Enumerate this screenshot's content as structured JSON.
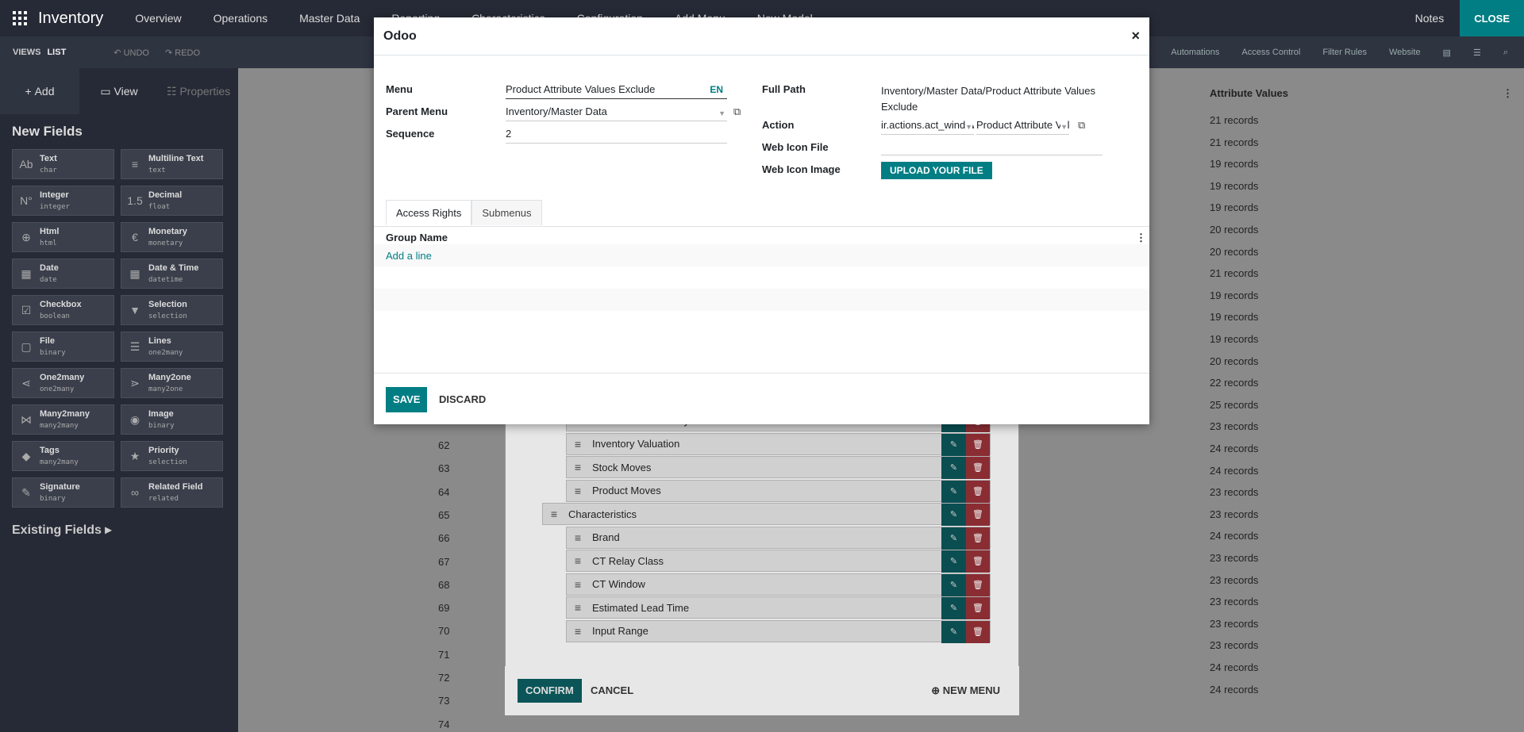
{
  "topbar": {
    "app_name": "Inventory",
    "menus": [
      "Overview",
      "Operations",
      "Master Data",
      "Reporting",
      "Characteristics",
      "Configuration",
      "Add Menu",
      "New Model"
    ],
    "notes": "Notes",
    "close": "CLOSE"
  },
  "subbar": {
    "views": "VIEWS",
    "list": "LIST",
    "undo": "UNDO",
    "redo": "REDO",
    "right_items": [
      "ations",
      "Automations",
      "Access Control",
      "Filter Rules",
      "Website"
    ]
  },
  "sidebar": {
    "tabs": {
      "add": "Add",
      "view": "View",
      "properties": "Properties"
    },
    "new_fields_title": "New Fields",
    "fields": [
      {
        "name": "Text",
        "type": "char",
        "icon": "Ab"
      },
      {
        "name": "Multiline Text",
        "type": "text",
        "icon": "≡"
      },
      {
        "name": "Integer",
        "type": "integer",
        "icon": "N°"
      },
      {
        "name": "Decimal",
        "type": "float",
        "icon": "1.5"
      },
      {
        "name": "Html",
        "type": "html",
        "icon": "⊕"
      },
      {
        "name": "Monetary",
        "type": "monetary",
        "icon": "€"
      },
      {
        "name": "Date",
        "type": "date",
        "icon": "▦"
      },
      {
        "name": "Date & Time",
        "type": "datetime",
        "icon": "▦"
      },
      {
        "name": "Checkbox",
        "type": "boolean",
        "icon": "☑"
      },
      {
        "name": "Selection",
        "type": "selection",
        "icon": "▼"
      },
      {
        "name": "File",
        "type": "binary",
        "icon": "▢"
      },
      {
        "name": "Lines",
        "type": "one2many",
        "icon": "☰"
      },
      {
        "name": "One2many",
        "type": "one2many",
        "icon": "⋖"
      },
      {
        "name": "Many2one",
        "type": "many2one",
        "icon": "⋗"
      },
      {
        "name": "Many2many",
        "type": "many2many",
        "icon": "⋈"
      },
      {
        "name": "Image",
        "type": "binary",
        "icon": "◉"
      },
      {
        "name": "Tags",
        "type": "many2many",
        "icon": "◆"
      },
      {
        "name": "Priority",
        "type": "selection",
        "icon": "★"
      },
      {
        "name": "Signature",
        "type": "binary",
        "icon": "✎"
      },
      {
        "name": "Related Field",
        "type": "related",
        "icon": "∞"
      }
    ],
    "existing_fields": "Existing Fields"
  },
  "list": {
    "column_header": "Attribute Values",
    "records": [
      "21 records",
      "21 records",
      "19 records",
      "19 records",
      "19 records",
      "20 records",
      "20 records",
      "21 records",
      "19 records",
      "19 records",
      "19 records",
      "20 records",
      "22 records",
      "25 records",
      "23 records",
      "24 records",
      "24 records",
      "23 records",
      "23 records",
      "24 records",
      "23 records",
      "23 records",
      "23 records",
      "23 records",
      "23 records",
      "24 records",
      "24 records"
    ],
    "row_numbers": [
      "62",
      "63",
      "64",
      "65",
      "66",
      "67",
      "68",
      "69",
      "70",
      "71",
      "72",
      "73",
      "74"
    ]
  },
  "menu_editor": {
    "items": [
      {
        "label": "Forecasted Inventory",
        "level": 2
      },
      {
        "label": "Inventory Valuation",
        "level": 2
      },
      {
        "label": "Stock Moves",
        "level": 2
      },
      {
        "label": "Product Moves",
        "level": 2
      },
      {
        "label": "Characteristics",
        "level": 1
      },
      {
        "label": "Brand",
        "level": 2
      },
      {
        "label": "CT Relay Class",
        "level": 2
      },
      {
        "label": "CT Window",
        "level": 2
      },
      {
        "label": "Estimated Lead Time",
        "level": 2
      },
      {
        "label": "Input Range",
        "level": 2
      }
    ],
    "confirm": "CONFIRM",
    "cancel": "CANCEL",
    "new_menu": "NEW MENU"
  },
  "modal": {
    "title": "Odoo",
    "close_symbol": "×",
    "menu_label": "Menu",
    "menu_value": "Product Attribute Values Exclude",
    "lang": "EN",
    "parent_menu_label": "Parent Menu",
    "parent_menu_value": "Inventory/Master Data",
    "sequence_label": "Sequence",
    "sequence_value": "2",
    "full_path_label": "Full Path",
    "full_path_value": "Inventory/Master Data/Product Attribute Values Exclude",
    "action_label": "Action",
    "action_model": "ir.actions.act_window",
    "action_record": "Product Attribute Values Exclude",
    "web_icon_file_label": "Web Icon File",
    "web_icon_image_label": "Web Icon Image",
    "upload_button": "UPLOAD YOUR FILE",
    "tabs": {
      "access_rights": "Access Rights",
      "submenus": "Submenus"
    },
    "group_name_header": "Group Name",
    "add_line": "Add a line",
    "save": "SAVE",
    "discard": "DISCARD"
  },
  "colors": {
    "accent": "#017e84",
    "danger": "#dc3545",
    "topbar": "#262a36"
  }
}
